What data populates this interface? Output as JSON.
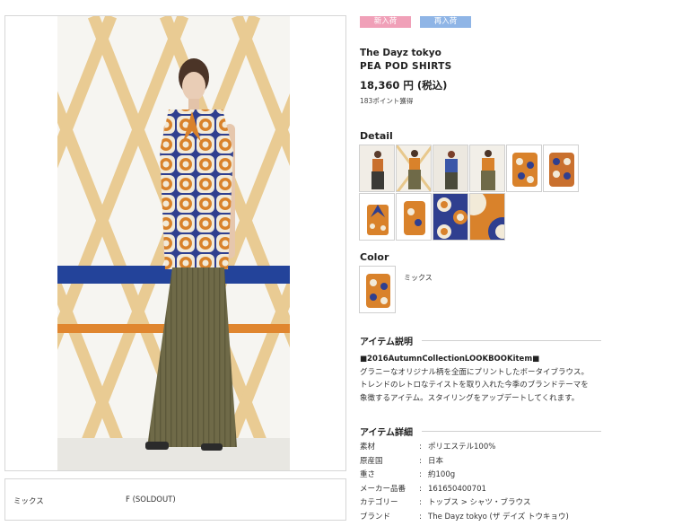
{
  "badges": {
    "new": "新入荷",
    "restock": "再入荷"
  },
  "product": {
    "brand": "The Dayz tokyo",
    "name": "PEA POD SHIRTS",
    "price": "18,360 円 (税込)",
    "points": "183ポイント獲得"
  },
  "detail": {
    "heading": "Detail",
    "thumbnails": [
      "model-full-1",
      "model-full-2",
      "model-full-3",
      "model-full-4",
      "shirt-front",
      "shirt-back",
      "shirt-bow",
      "shirt-side",
      "fabric-closeup",
      "fabric-pattern"
    ]
  },
  "color": {
    "heading": "Color",
    "name": "ミックス"
  },
  "description": {
    "heading": "アイテム説明",
    "lead": "■2016AutumnCollectionLOOKBOOKitem■",
    "lines": [
      "グラニーなオリジナル柄を全面にプリントしたボータイブラウス。",
      "トレンドのレトロなテイストを取り入れた今季のブランドテーマを",
      "象徴するアイテム。スタイリングをアップデートしてくれます。"
    ]
  },
  "specs": {
    "heading": "アイテム詳細",
    "separator": ":",
    "rows": [
      {
        "label": "素材",
        "value": "ポリエステル100%"
      },
      {
        "label": "原産国",
        "value": "日本"
      },
      {
        "label": "重さ",
        "value": "約100g"
      },
      {
        "label": "メーカー品番",
        "value": "161650400701"
      },
      {
        "label": "カテゴリー",
        "value": "トップス > シャツ・ブラウス"
      },
      {
        "label": "ブランド",
        "value": "The Dayz tokyo (ザ デイズ トウキョウ)"
      }
    ]
  },
  "variant": {
    "color": "ミックス",
    "size": "F (SOLDOUT)"
  }
}
